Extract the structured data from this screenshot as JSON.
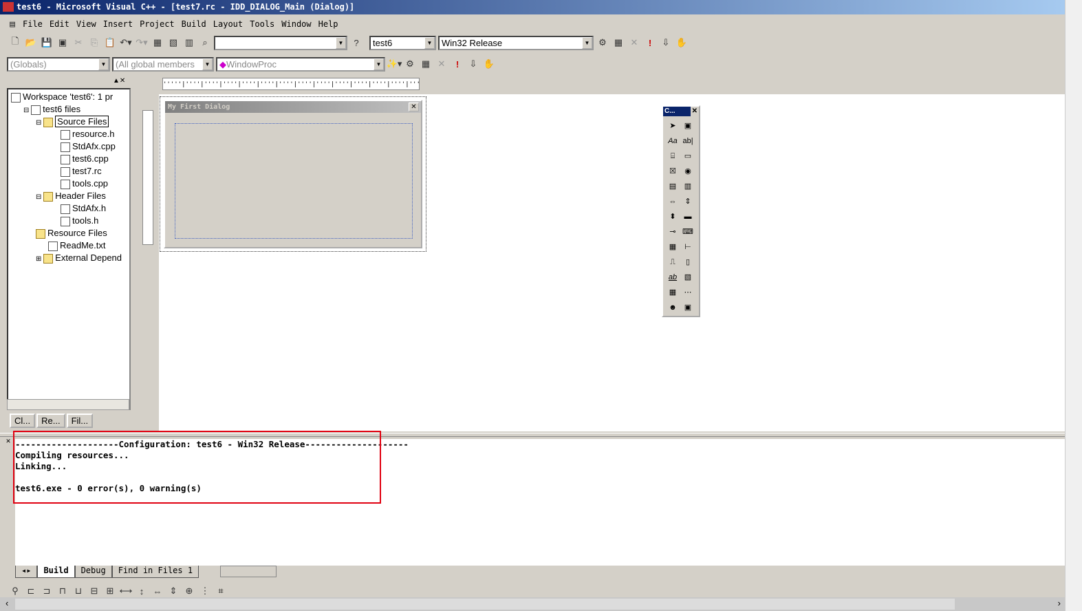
{
  "window": {
    "title": "test6 - Microsoft Visual C++ - [test7.rc - IDD_DIALOG_Main (Dialog)]"
  },
  "menu": [
    "File",
    "Edit",
    "View",
    "Insert",
    "Project",
    "Build",
    "Layout",
    "Tools",
    "Window",
    "Help"
  ],
  "toolbar": {
    "find_value": "",
    "project_combo": "test6",
    "config_combo": "Win32 Release"
  },
  "wizardbar": {
    "class_combo": "(Globals)",
    "filter_combo": "(All global members",
    "member_combo": "WindowProc"
  },
  "workspace": {
    "items": [
      {
        "label": "Workspace 'test6': 1 pr",
        "level": 0,
        "type": "ws"
      },
      {
        "label": "test6 files",
        "level": 1,
        "type": "proj"
      },
      {
        "label": "Source Files",
        "level": 2,
        "type": "folder",
        "selected": true
      },
      {
        "label": "resource.h",
        "level": 3,
        "type": "file"
      },
      {
        "label": "StdAfx.cpp",
        "level": 3,
        "type": "file"
      },
      {
        "label": "test6.cpp",
        "level": 3,
        "type": "file"
      },
      {
        "label": "test7.rc",
        "level": 3,
        "type": "file"
      },
      {
        "label": "tools.cpp",
        "level": 3,
        "type": "file"
      },
      {
        "label": "Header Files",
        "level": 2,
        "type": "folder"
      },
      {
        "label": "StdAfx.h",
        "level": 3,
        "type": "file"
      },
      {
        "label": "tools.h",
        "level": 3,
        "type": "file"
      },
      {
        "label": "Resource Files",
        "level": 2,
        "type": "folder"
      },
      {
        "label": "ReadMe.txt",
        "level": 2,
        "type": "file"
      },
      {
        "label": "External Depend",
        "level": 2,
        "type": "folder"
      }
    ],
    "tabs": [
      "Cl...",
      "Re...",
      "Fil..."
    ]
  },
  "dialog": {
    "title": "My First Dialog"
  },
  "controls": {
    "title": "C..."
  },
  "output": {
    "lines": [
      "--------------------Configuration: test6 - Win32 Release--------------------",
      "Compiling resources...",
      "Linking...",
      "",
      "test6.exe - 0 error(s), 0 warning(s)"
    ],
    "tabs": [
      "Build",
      "Debug",
      "Find in Files 1"
    ]
  },
  "colors": {
    "highlight_box": "#e00010",
    "titlebar": "#0a246a"
  }
}
